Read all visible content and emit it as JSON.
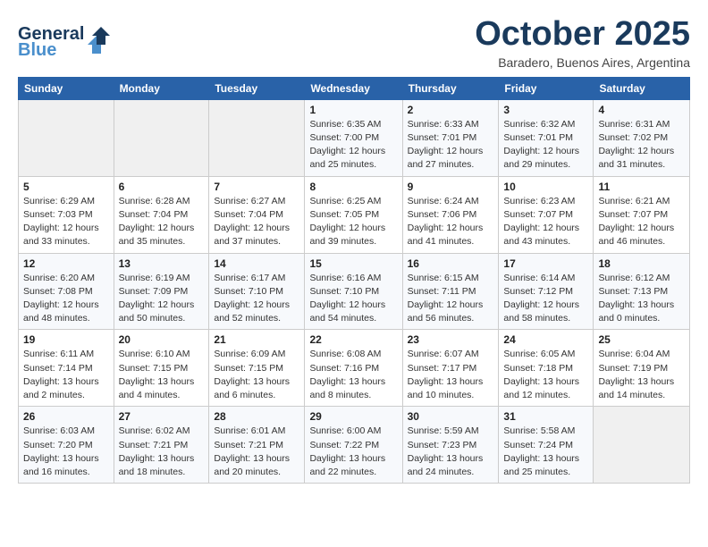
{
  "header": {
    "logo_general": "General",
    "logo_blue": "Blue",
    "month_title": "October 2025",
    "subtitle": "Baradero, Buenos Aires, Argentina"
  },
  "weekdays": [
    "Sunday",
    "Monday",
    "Tuesday",
    "Wednesday",
    "Thursday",
    "Friday",
    "Saturday"
  ],
  "weeks": [
    [
      {
        "day": "",
        "info": ""
      },
      {
        "day": "",
        "info": ""
      },
      {
        "day": "",
        "info": ""
      },
      {
        "day": "1",
        "info": "Sunrise: 6:35 AM\nSunset: 7:00 PM\nDaylight: 12 hours\nand 25 minutes."
      },
      {
        "day": "2",
        "info": "Sunrise: 6:33 AM\nSunset: 7:01 PM\nDaylight: 12 hours\nand 27 minutes."
      },
      {
        "day": "3",
        "info": "Sunrise: 6:32 AM\nSunset: 7:01 PM\nDaylight: 12 hours\nand 29 minutes."
      },
      {
        "day": "4",
        "info": "Sunrise: 6:31 AM\nSunset: 7:02 PM\nDaylight: 12 hours\nand 31 minutes."
      }
    ],
    [
      {
        "day": "5",
        "info": "Sunrise: 6:29 AM\nSunset: 7:03 PM\nDaylight: 12 hours\nand 33 minutes."
      },
      {
        "day": "6",
        "info": "Sunrise: 6:28 AM\nSunset: 7:04 PM\nDaylight: 12 hours\nand 35 minutes."
      },
      {
        "day": "7",
        "info": "Sunrise: 6:27 AM\nSunset: 7:04 PM\nDaylight: 12 hours\nand 37 minutes."
      },
      {
        "day": "8",
        "info": "Sunrise: 6:25 AM\nSunset: 7:05 PM\nDaylight: 12 hours\nand 39 minutes."
      },
      {
        "day": "9",
        "info": "Sunrise: 6:24 AM\nSunset: 7:06 PM\nDaylight: 12 hours\nand 41 minutes."
      },
      {
        "day": "10",
        "info": "Sunrise: 6:23 AM\nSunset: 7:07 PM\nDaylight: 12 hours\nand 43 minutes."
      },
      {
        "day": "11",
        "info": "Sunrise: 6:21 AM\nSunset: 7:07 PM\nDaylight: 12 hours\nand 46 minutes."
      }
    ],
    [
      {
        "day": "12",
        "info": "Sunrise: 6:20 AM\nSunset: 7:08 PM\nDaylight: 12 hours\nand 48 minutes."
      },
      {
        "day": "13",
        "info": "Sunrise: 6:19 AM\nSunset: 7:09 PM\nDaylight: 12 hours\nand 50 minutes."
      },
      {
        "day": "14",
        "info": "Sunrise: 6:17 AM\nSunset: 7:10 PM\nDaylight: 12 hours\nand 52 minutes."
      },
      {
        "day": "15",
        "info": "Sunrise: 6:16 AM\nSunset: 7:10 PM\nDaylight: 12 hours\nand 54 minutes."
      },
      {
        "day": "16",
        "info": "Sunrise: 6:15 AM\nSunset: 7:11 PM\nDaylight: 12 hours\nand 56 minutes."
      },
      {
        "day": "17",
        "info": "Sunrise: 6:14 AM\nSunset: 7:12 PM\nDaylight: 12 hours\nand 58 minutes."
      },
      {
        "day": "18",
        "info": "Sunrise: 6:12 AM\nSunset: 7:13 PM\nDaylight: 13 hours\nand 0 minutes."
      }
    ],
    [
      {
        "day": "19",
        "info": "Sunrise: 6:11 AM\nSunset: 7:14 PM\nDaylight: 13 hours\nand 2 minutes."
      },
      {
        "day": "20",
        "info": "Sunrise: 6:10 AM\nSunset: 7:15 PM\nDaylight: 13 hours\nand 4 minutes."
      },
      {
        "day": "21",
        "info": "Sunrise: 6:09 AM\nSunset: 7:15 PM\nDaylight: 13 hours\nand 6 minutes."
      },
      {
        "day": "22",
        "info": "Sunrise: 6:08 AM\nSunset: 7:16 PM\nDaylight: 13 hours\nand 8 minutes."
      },
      {
        "day": "23",
        "info": "Sunrise: 6:07 AM\nSunset: 7:17 PM\nDaylight: 13 hours\nand 10 minutes."
      },
      {
        "day": "24",
        "info": "Sunrise: 6:05 AM\nSunset: 7:18 PM\nDaylight: 13 hours\nand 12 minutes."
      },
      {
        "day": "25",
        "info": "Sunrise: 6:04 AM\nSunset: 7:19 PM\nDaylight: 13 hours\nand 14 minutes."
      }
    ],
    [
      {
        "day": "26",
        "info": "Sunrise: 6:03 AM\nSunset: 7:20 PM\nDaylight: 13 hours\nand 16 minutes."
      },
      {
        "day": "27",
        "info": "Sunrise: 6:02 AM\nSunset: 7:21 PM\nDaylight: 13 hours\nand 18 minutes."
      },
      {
        "day": "28",
        "info": "Sunrise: 6:01 AM\nSunset: 7:21 PM\nDaylight: 13 hours\nand 20 minutes."
      },
      {
        "day": "29",
        "info": "Sunrise: 6:00 AM\nSunset: 7:22 PM\nDaylight: 13 hours\nand 22 minutes."
      },
      {
        "day": "30",
        "info": "Sunrise: 5:59 AM\nSunset: 7:23 PM\nDaylight: 13 hours\nand 24 minutes."
      },
      {
        "day": "31",
        "info": "Sunrise: 5:58 AM\nSunset: 7:24 PM\nDaylight: 13 hours\nand 25 minutes."
      },
      {
        "day": "",
        "info": ""
      }
    ]
  ]
}
